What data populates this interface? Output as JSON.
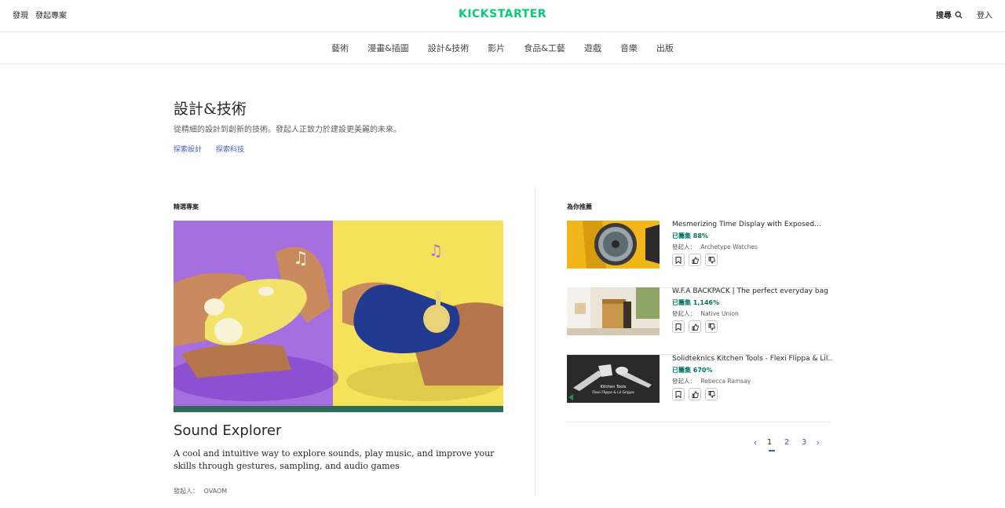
{
  "header": {
    "left_links": [
      "發現",
      "發起專案"
    ],
    "logo_text": "KICKSTARTER",
    "search_label": "搜尋",
    "login_label": "登入"
  },
  "category_nav": [
    "藝術",
    "漫畫&插圖",
    "設計&技術",
    "影片",
    "食品&工藝",
    "遊戲",
    "音樂",
    "出版"
  ],
  "category": {
    "title": "設計&技術",
    "description": "從精細的設計到創新的技術。發起人正致力於建設更美麗的未來。",
    "links": [
      "探索設計",
      "探索科技"
    ]
  },
  "featured": {
    "section_label": "精選專案",
    "title": "Sound Explorer",
    "description": "A cool and intuitive way to explore sounds, play music, and improve your skills through gestures, sampling, and audio games",
    "creator_label": "發起人：",
    "creator": "OVAOM"
  },
  "recommended": {
    "section_label": "為你推薦",
    "items": [
      {
        "title": "Mesmerizing Time Display with Exposed…",
        "funded": "已籌集 88%",
        "creator_label": "發起人：",
        "creator": "Archetype Watches"
      },
      {
        "title": "W.F.A BACKPACK | The perfect everyday bag",
        "funded": "已籌集 1,146%",
        "creator_label": "發起人：",
        "creator": "Native Union"
      },
      {
        "title": "Solidteknics Kitchen Tools - Flexi Flippa & Lil…",
        "funded": "已籌集 670%",
        "creator_label": "發起人：",
        "creator": "Rebecca Ramsay"
      }
    ],
    "thumb3_caption": "Kitchen Tools",
    "thumb3_sub": "Flexi Flippa & Lil Grippa"
  },
  "pagination": {
    "prev_icon": "chevron-left-icon",
    "pages": [
      "1",
      "2",
      "3"
    ],
    "current": "1",
    "next_icon": "chevron-right-icon"
  },
  "colors": {
    "brand_green": "#05ce78",
    "funded_green": "#037362",
    "link_blue": "#3c5cc0"
  }
}
